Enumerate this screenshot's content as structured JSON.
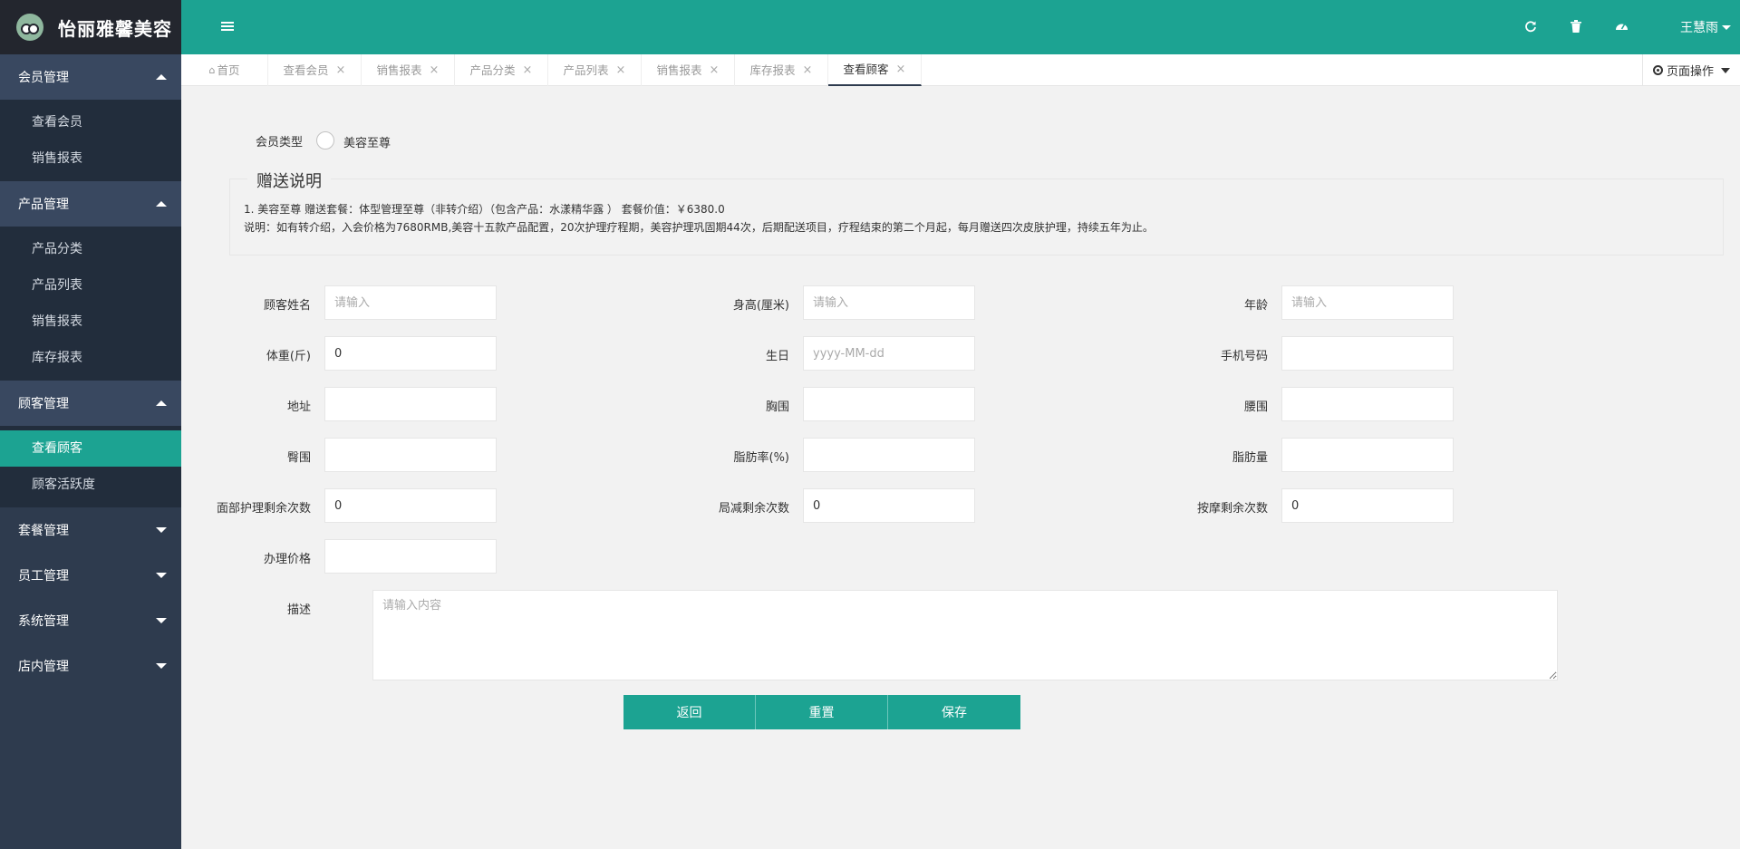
{
  "app": {
    "title": "怡丽雅馨美容"
  },
  "sidebar": {
    "groups": [
      {
        "label": "会员管理",
        "items": [
          "查看会员",
          "销售报表"
        ]
      },
      {
        "label": "产品管理",
        "items": [
          "产品分类",
          "产品列表",
          "销售报表",
          "库存报表"
        ]
      },
      {
        "label": "顾客管理",
        "items": [
          "查看顾客",
          "顾客活跃度"
        ]
      },
      {
        "label": "套餐管理"
      },
      {
        "label": "员工管理"
      },
      {
        "label": "系统管理"
      },
      {
        "label": "店内管理"
      }
    ]
  },
  "header": {
    "user": "王慧雨"
  },
  "tabs": [
    {
      "label": "首页"
    },
    {
      "label": "查看会员"
    },
    {
      "label": "销售报表"
    },
    {
      "label": "产品分类"
    },
    {
      "label": "产品列表"
    },
    {
      "label": "销售报表"
    },
    {
      "label": "库存报表"
    },
    {
      "label": "查看顾客"
    }
  ],
  "page_ops_label": "页面操作",
  "form": {
    "member_type_label": "会员类型",
    "member_type_option": "美容至尊",
    "gift_legend": "赠送说明",
    "gift_line1": "1. 美容至尊   赠送套餐：体型管理至尊（非转介绍）（包含产品：水漾精华露 ）  套餐价值：￥6380.0",
    "gift_line2": "说明：如有转介绍，入会价格为7680RMB,美容十五款产品配置，20次护理疗程期，美容护理巩固期44次，后期配送项目，疗程结束的第二个月起，每月赠送四次皮肤护理，持续五年为止。",
    "fields": {
      "name": {
        "label": "顾客姓名",
        "value": "",
        "placeholder": "请输入"
      },
      "height": {
        "label": "身高(厘米)",
        "value": "",
        "placeholder": "请输入"
      },
      "age": {
        "label": "年龄",
        "value": "",
        "placeholder": "请输入"
      },
      "weight": {
        "label": "体重(斤)",
        "value": "0",
        "placeholder": ""
      },
      "birthday": {
        "label": "生日",
        "value": "",
        "placeholder": "yyyy-MM-dd"
      },
      "phone": {
        "label": "手机号码",
        "value": "",
        "placeholder": ""
      },
      "address": {
        "label": "地址",
        "value": "",
        "placeholder": ""
      },
      "chest": {
        "label": "胸围",
        "value": "",
        "placeholder": ""
      },
      "waist": {
        "label": "腰围",
        "value": "",
        "placeholder": ""
      },
      "hip": {
        "label": "臀围",
        "value": "",
        "placeholder": ""
      },
      "fat_rate": {
        "label": "脂肪率(%)",
        "value": "",
        "placeholder": ""
      },
      "fat_amount": {
        "label": "脂肪量",
        "value": "",
        "placeholder": ""
      },
      "face_left": {
        "label": "面部护理剩余次数",
        "value": "0",
        "placeholder": ""
      },
      "local_left": {
        "label": "局减剩余次数",
        "value": "0",
        "placeholder": ""
      },
      "massage_left": {
        "label": "按摩剩余次数",
        "value": "0",
        "placeholder": ""
      },
      "price": {
        "label": "办理价格",
        "value": "",
        "placeholder": ""
      },
      "desc": {
        "label": "描述",
        "value": "",
        "placeholder": "请输入内容"
      }
    },
    "buttons": {
      "back": "返回",
      "reset": "重置",
      "save": "保存"
    }
  }
}
